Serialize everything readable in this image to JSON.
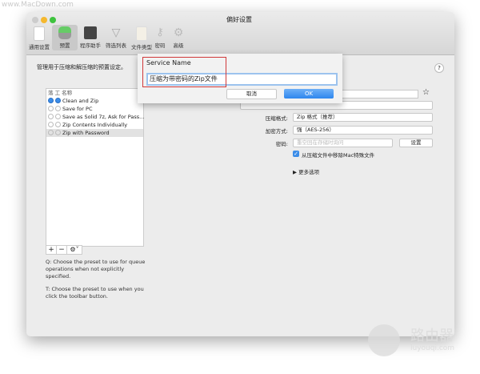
{
  "watermark_top": "www.MacDown.com",
  "watermark_bottom": {
    "brand": "路由器",
    "url": "luyouqi.com"
  },
  "window": {
    "title": "偏好设置"
  },
  "toolbar": [
    {
      "label": "通用设置"
    },
    {
      "label": "预置"
    },
    {
      "label": "程序助手"
    },
    {
      "label": "筛选列表"
    },
    {
      "label": "文件类型"
    },
    {
      "label": "密码"
    },
    {
      "label": "高级"
    }
  ],
  "main": {
    "description": "管理用于压缩和解压缩的预置设定。",
    "list_header": "落 工 名称",
    "presets": [
      {
        "name": "Clean and Zip",
        "q": true,
        "t": true
      },
      {
        "name": "Save for PC",
        "q": false,
        "t": false
      },
      {
        "name": "Save as Solid 7z, Ask for Pass...",
        "q": false,
        "t": false
      },
      {
        "name": "Zip Contents Individually",
        "q": false,
        "t": false
      },
      {
        "name": "Zip with Password",
        "q": false,
        "t": false,
        "selected": true
      }
    ],
    "help_q": "Q: Choose the preset to use for queue operations when not explicitly specified.",
    "help_t": "T: Choose the preset to use when you click the toolbar button.",
    "help_button": "?"
  },
  "settings": {
    "format_label": "压缩格式:",
    "format_value": "Zip 格式（推荐）",
    "encryption_label": "加密方式:",
    "encryption_value": "强（AES-256）",
    "password_label": "密码:",
    "password_placeholder": "重空回在存储时询问",
    "set_button": "设置",
    "remove_mac_files": "从压缩文件中移除Mac特殊文件",
    "remove_checked": true,
    "more_options": "更多选项"
  },
  "dialog": {
    "label": "Service Name",
    "value": "压缩为带密码的Zip文件",
    "cancel": "取消",
    "ok": "OK"
  }
}
